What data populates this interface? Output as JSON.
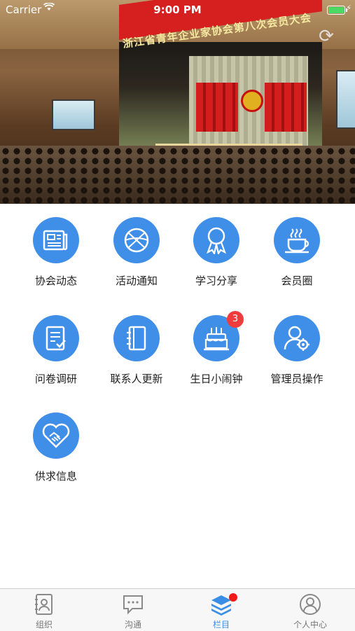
{
  "status_bar": {
    "carrier": "Carrier",
    "time": "9:00 PM"
  },
  "banner": {
    "sign_text": "浙江省青年企业家协会第八次会员大会"
  },
  "menu": [
    {
      "label": "协会动态",
      "icon": "newspaper-icon"
    },
    {
      "label": "活动通知",
      "icon": "basketball-icon"
    },
    {
      "label": "学习分享",
      "icon": "award-ribbon-icon"
    },
    {
      "label": "会员圈",
      "icon": "coffee-cup-icon"
    },
    {
      "label": "问卷调研",
      "icon": "survey-checklist-icon"
    },
    {
      "label": "联系人更新",
      "icon": "contact-book-icon"
    },
    {
      "label": "生日小闹钟",
      "icon": "birthday-cake-icon",
      "badge": "3"
    },
    {
      "label": "管理员操作",
      "icon": "admin-user-gear-icon"
    },
    {
      "label": "供求信息",
      "icon": "handshake-heart-icon"
    }
  ],
  "tabbar": {
    "tabs": [
      {
        "label": "组织",
        "icon": "organization-icon"
      },
      {
        "label": "沟通",
        "icon": "chat-bubble-icon"
      },
      {
        "label": "栏目",
        "icon": "layers-icon",
        "active": true
      },
      {
        "label": "个人中心",
        "icon": "user-profile-icon"
      }
    ]
  },
  "colors": {
    "accent": "#3f8ee8",
    "badge": "#f03c3c",
    "tab_active": "#3a8ee6"
  }
}
